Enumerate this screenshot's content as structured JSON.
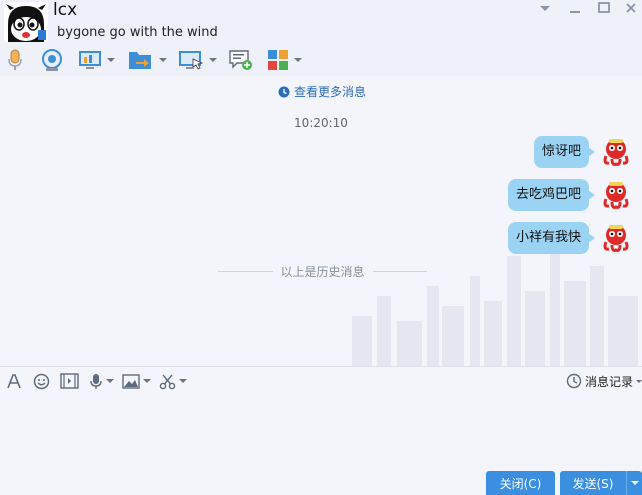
{
  "header": {
    "contact_name": "lcx",
    "contact_status": "bygone go with the wind"
  },
  "window_controls": [
    "minimize-icon",
    "maximize-icon",
    "close-icon"
  ],
  "toolbar": {
    "items": [
      "microphone-icon",
      "webcam-icon",
      "screen-share-icon",
      "file-transfer-icon",
      "remote-assist-icon",
      "new-chat-icon",
      "apps-icon"
    ]
  },
  "chat": {
    "more_messages": "查看更多消息",
    "timestamp": "10:20:10",
    "messages": [
      {
        "text": "惊讶吧",
        "from": "self"
      },
      {
        "text": "去吃鸡巴吧",
        "from": "self"
      },
      {
        "text": "小祥有我快",
        "from": "self"
      }
    ],
    "history_divider": "以上是历史消息"
  },
  "input_toolbar": {
    "items": [
      "font-icon",
      "emoji-icon",
      "gif-icon",
      "voice-icon",
      "image-icon",
      "screenshot-icon"
    ],
    "history_label": "消息记录"
  },
  "buttons": {
    "close": "关闭(C)",
    "send": "发送(S)"
  },
  "colors": {
    "accent": "#3a8fe0",
    "bubble": "#9bd3f5",
    "link": "#2c6cb8"
  }
}
